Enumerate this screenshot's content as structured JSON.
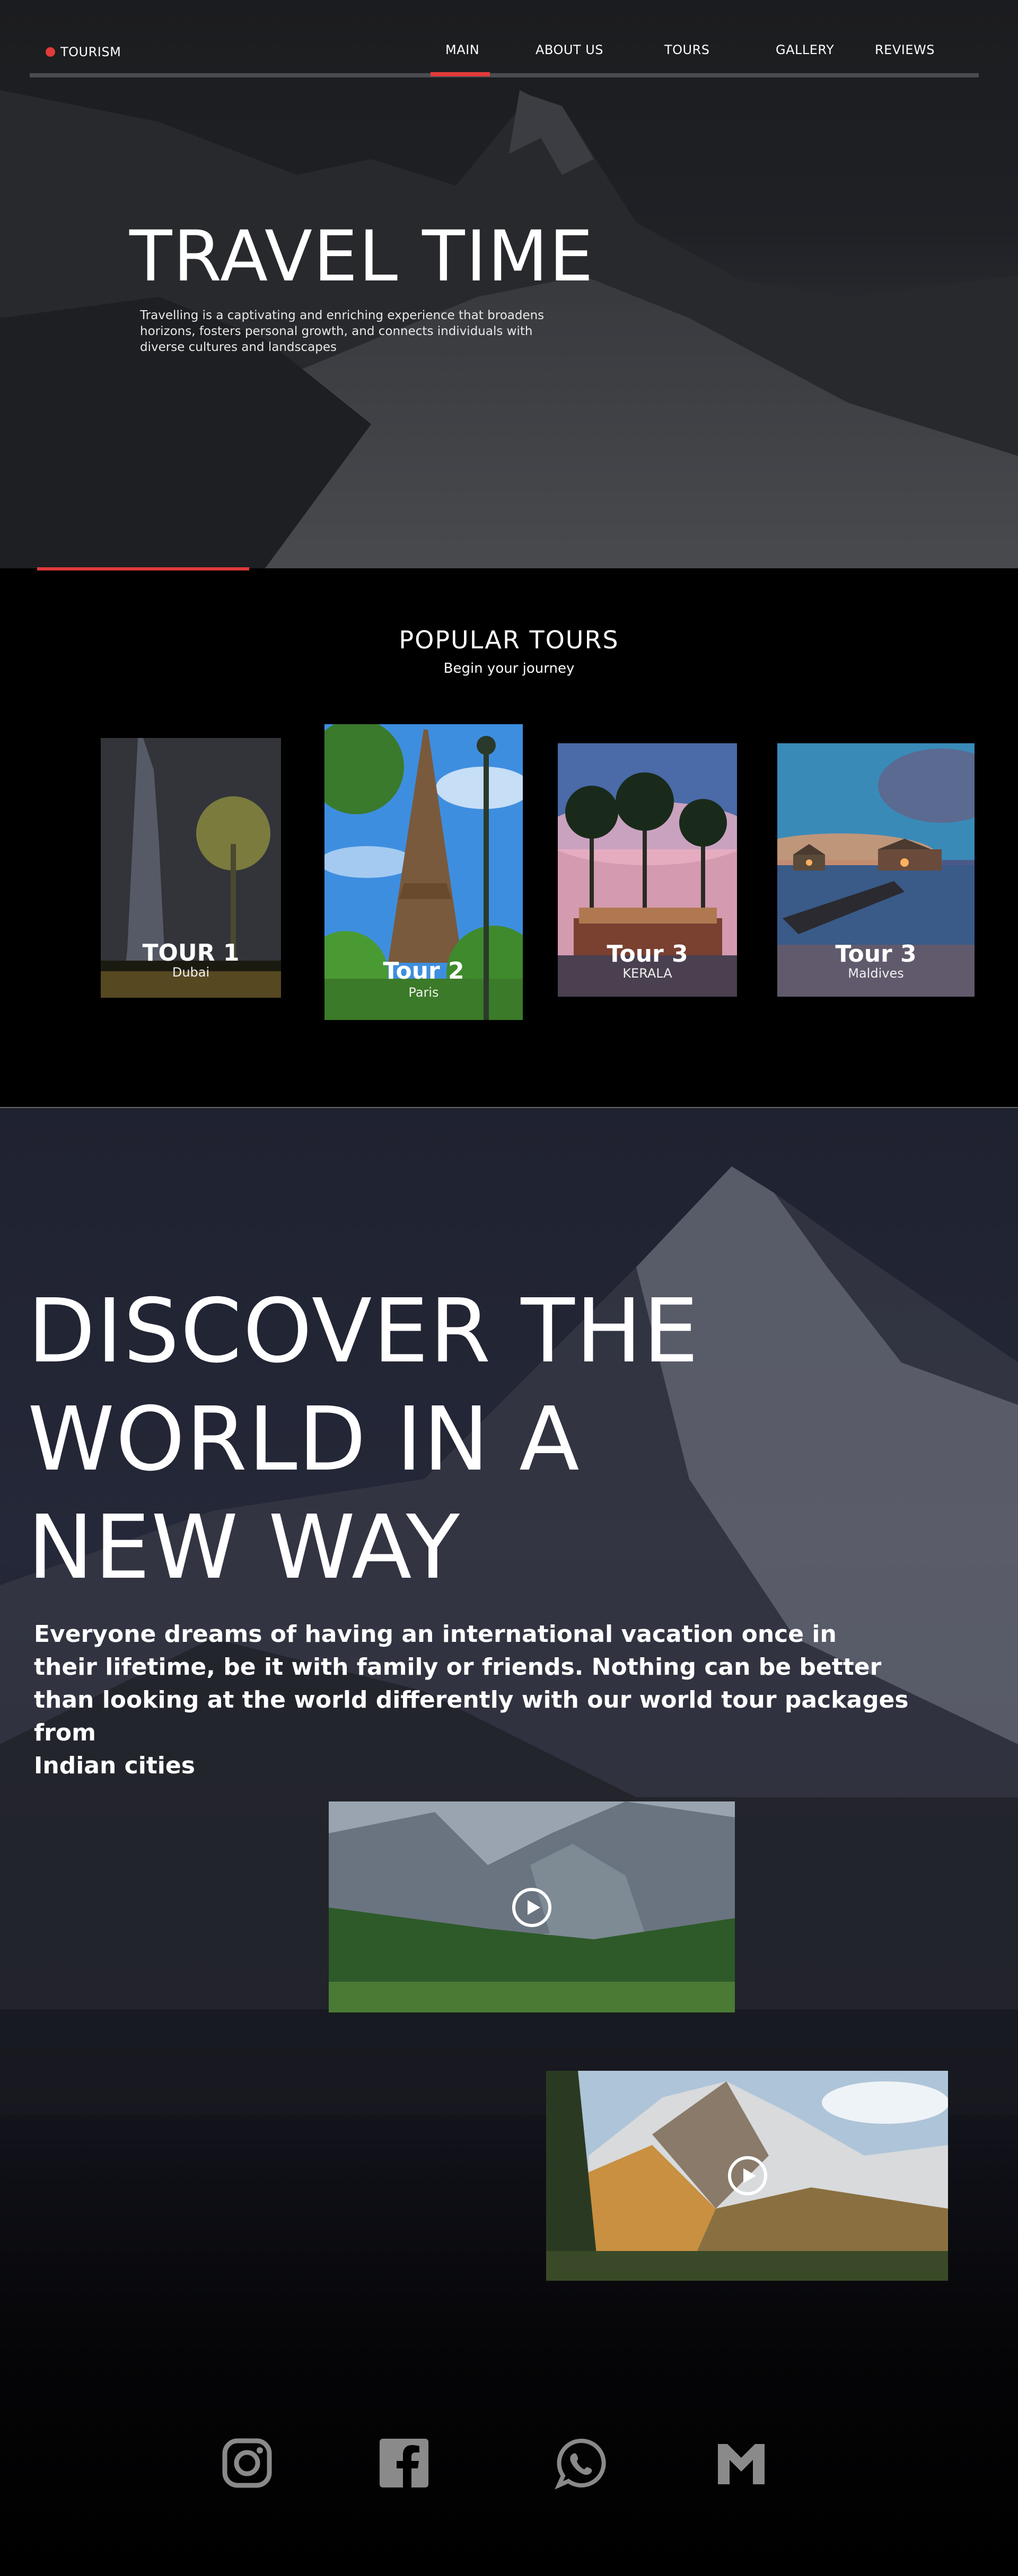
{
  "nav": {
    "brand": "TOURISM",
    "items": [
      {
        "label": "MAIN",
        "active": true
      },
      {
        "label": "ABOUT US",
        "active": false
      },
      {
        "label": "TOURS",
        "active": false
      },
      {
        "label": "GALLERY",
        "active": false
      },
      {
        "label": "REVIEWS",
        "active": false
      }
    ]
  },
  "hero": {
    "title": "TRAVEL TIME",
    "text": "Travelling is a captivating and enriching experience that broadens\n horizons, fosters personal growth, and connects individuals with\ndiverse cultures and landscapes"
  },
  "tours": {
    "title": "POPULAR  TOURS",
    "subtitle": "Begin your journey",
    "cards": [
      {
        "name": "TOUR 1",
        "place": "Dubai"
      },
      {
        "name": "Tour 2",
        "place": "Paris"
      },
      {
        "name": "Tour 3",
        "place": "KERALA"
      },
      {
        "name": "Tour 3",
        "place": "Maldives"
      }
    ]
  },
  "discover": {
    "title": "DISCOVER THE\nWORLD IN A\nNEW WAY",
    "text": "Everyone dreams of having an international vacation once in\n their lifetime, be it with family or friends. Nothing can be better\n than looking at the world differently with our world tour packages from\n Indian cities"
  },
  "social": [
    {
      "icon": "instagram-icon"
    },
    {
      "icon": "facebook-icon"
    },
    {
      "icon": "whatsapp-icon"
    },
    {
      "icon": "gmail-icon"
    }
  ],
  "colors": {
    "accent": "#e23a3a",
    "background": "#000000",
    "social_icon": "#8a8a8a"
  }
}
